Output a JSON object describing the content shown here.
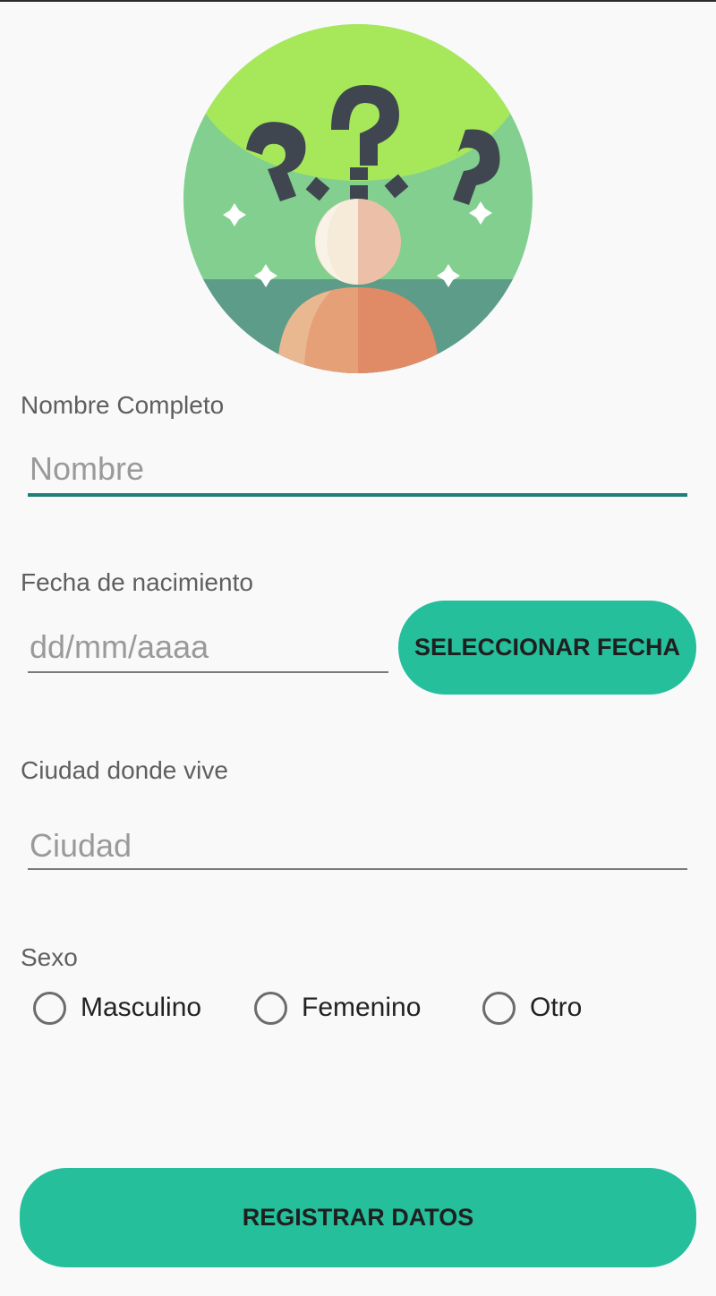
{
  "avatar": {
    "icon": "confused-person-icon"
  },
  "form": {
    "name": {
      "label": "Nombre Completo",
      "placeholder": "Nombre",
      "value": ""
    },
    "birthdate": {
      "label": "Fecha de nacimiento",
      "placeholder": "dd/mm/aaaa",
      "value": "",
      "button_label": "SELECCIONAR FECHA"
    },
    "city": {
      "label": "Ciudad donde vive",
      "placeholder": "Ciudad",
      "value": ""
    },
    "sex": {
      "label": "Sexo",
      "options": [
        {
          "label": "Masculino",
          "selected": false
        },
        {
          "label": "Femenino",
          "selected": false
        },
        {
          "label": "Otro",
          "selected": false
        }
      ]
    }
  },
  "submit": {
    "label": "REGISTRAR DATOS"
  },
  "colors": {
    "accent": "#25bf9c",
    "focus_underline": "#1e7f78",
    "background": "#f9f9fa"
  }
}
